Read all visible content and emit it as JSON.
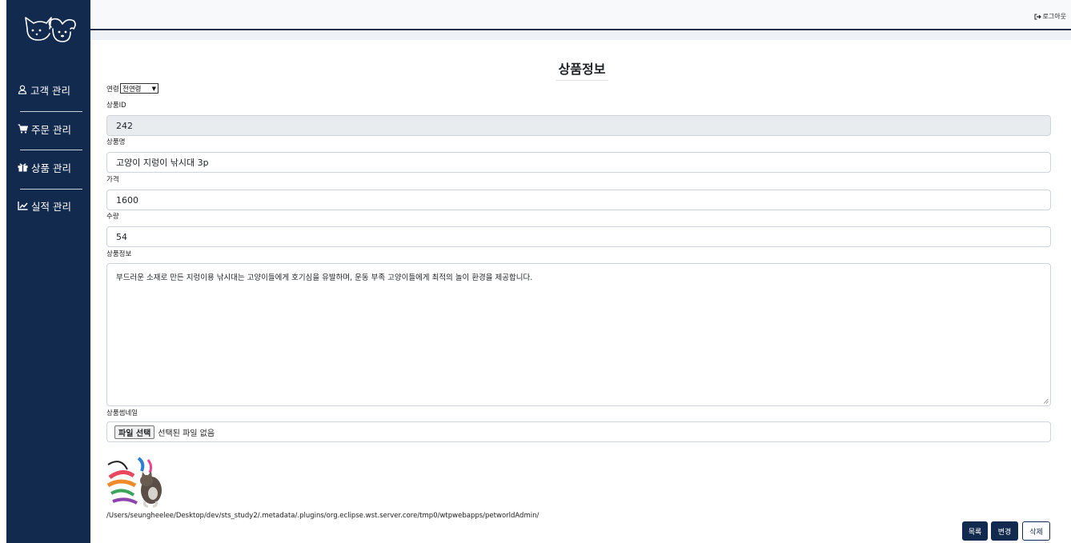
{
  "sidebar": {
    "logo_name": "dog-cat-logo",
    "items": [
      {
        "label": "고객 관리",
        "icon": "user-icon"
      },
      {
        "label": "주문 관리",
        "icon": "cart-icon"
      },
      {
        "label": "상품 관리",
        "icon": "gift-icon"
      },
      {
        "label": "실적 관리",
        "icon": "chart-line-icon"
      }
    ]
  },
  "header": {
    "logout_label": "로그아웃",
    "logout_icon": "sign-out-icon"
  },
  "page": {
    "title": "상품정보"
  },
  "form": {
    "age_label": "연령",
    "age_selected": "전연령",
    "id_label": "상품ID",
    "id_value": "242",
    "name_label": "상품명",
    "name_value": "고양이 지렁이 낚시대 3p",
    "price_label": "가격",
    "price_value": "1600",
    "quantity_label": "수량",
    "quantity_value": "54",
    "info_label": "상품정보",
    "info_value": "부드러운 소재로 만든 지렁이용 낚시대는 고양이들에게 호기심을 유발하며, 운동 부족 고양이들에게 최적의 놀이 환경을 제공합니다.",
    "thumbnail_label": "상품썸네일",
    "file_button": "파일 선택",
    "file_status": "선택된 파일 없음",
    "upload_path": "/Users/seungheelee/Desktop/dev/sts_study2/.metadata/.plugins/org.eclipse.wst.server.core/tmp0/wtpwebapps/petworldAdmin/"
  },
  "actions": {
    "list_label": "목록",
    "update_label": "변경",
    "delete_label": "삭제"
  },
  "colors": {
    "sidebar_bg": "#132a4f",
    "accent": "#132a4f"
  }
}
